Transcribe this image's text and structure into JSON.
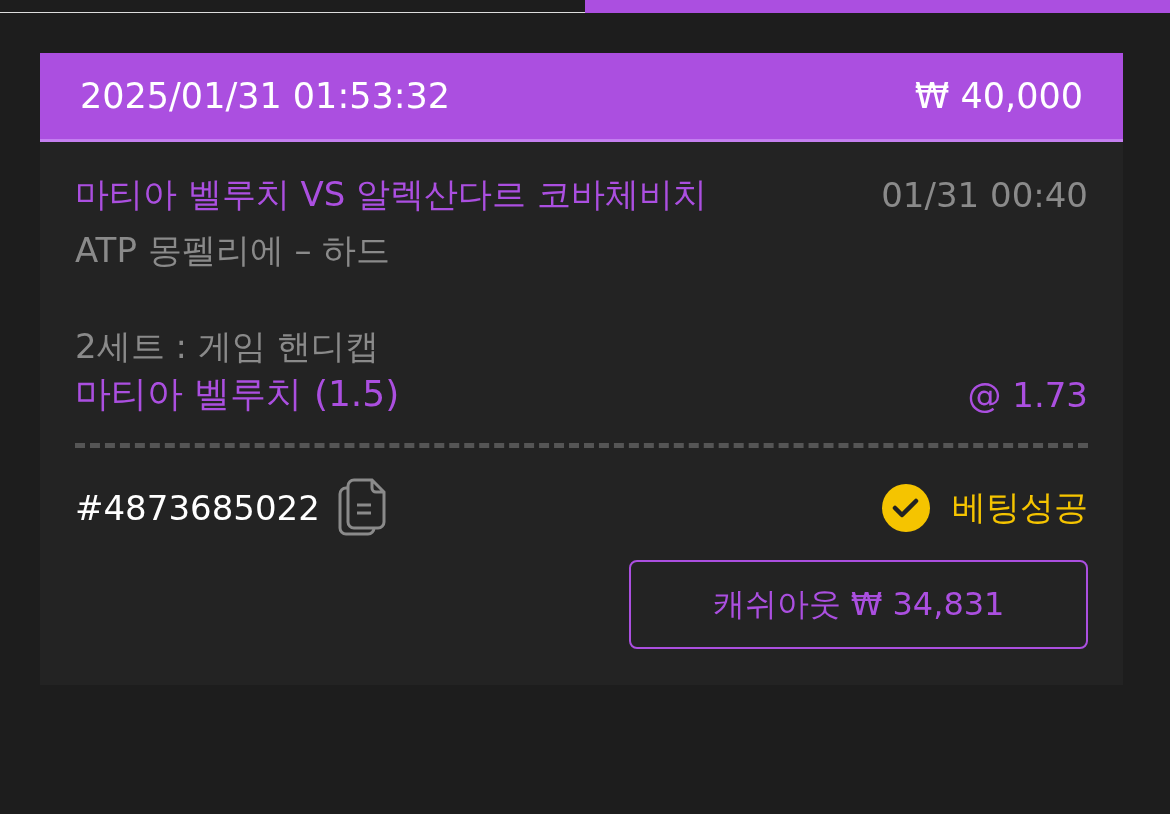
{
  "tabs": [
    {
      "selected": false
    },
    {
      "selected": true
    }
  ],
  "bet_card": {
    "datetime": "2025/01/31 01:53:32",
    "amount": "₩ 40,000",
    "match": "마티아 벨루치 VS 알렉산다르 코바체비치",
    "match_time": "01/31 00:40",
    "league": "ATP 몽펠리에 – 하드",
    "market": "2세트 : 게임 핸디캡",
    "pick": "마티아 벨루치 (1.5)",
    "odds": "@ 1.73",
    "ticket_id": "#4873685022",
    "status": {
      "kind": "success",
      "label": "베팅성공"
    },
    "cashout_button": "캐쉬아웃 ₩ 34,831"
  }
}
